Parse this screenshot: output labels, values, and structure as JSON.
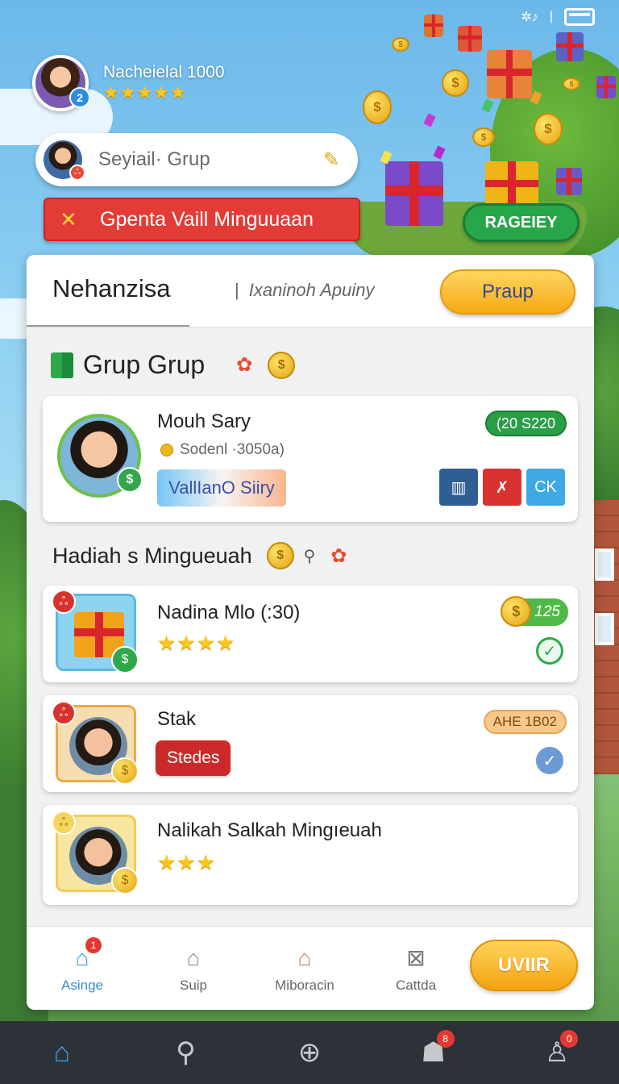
{
  "profile": {
    "name": "Nacheielal 1000",
    "level": "2",
    "stars": "★★★★★"
  },
  "group_field": {
    "text": "Seyiail· Grup",
    "avatar_badge": "ஃ"
  },
  "banner": {
    "text": "Gpenta Vaill Minguuaan"
  },
  "rageiey_button": "RAGEIEY",
  "panel": {
    "tab_active": "Nehanzisa",
    "tab_secondary": "Ixaninoh Apuiny",
    "praup_button": "Praup"
  },
  "section1": {
    "title": "Grup Grup"
  },
  "group_card": {
    "name": "Mouh Sary",
    "sub": "Sodenl ·3050a)",
    "tag": "VallIanO Siiry",
    "pill": "(20 S220",
    "buttons": [
      "▥",
      "✗",
      "CK"
    ]
  },
  "section2": {
    "title": "Hadiah s Mingueuah"
  },
  "rewards": [
    {
      "title": "Nadina Mlo (:30)",
      "stars": "★★★★",
      "coin_value": "125",
      "badge": "ஃ"
    },
    {
      "title": "Stak",
      "action": "Stedes",
      "pill": "AHE 1B02",
      "badge": "ஃ"
    },
    {
      "title": "Nalikah Salkah Mingıeuah",
      "stars": "★★★",
      "badge": "ஃ"
    }
  ],
  "app_nav": {
    "items": [
      {
        "label": "Asinge",
        "badge": "1"
      },
      {
        "label": "Suip"
      },
      {
        "label": "Miboracin"
      },
      {
        "label": "Cattda"
      }
    ],
    "cta": "UVIIR"
  },
  "system_nav": {
    "badges": [
      "8",
      "0"
    ]
  },
  "colors": {
    "accent_blue": "#3b8ed6",
    "danger_red": "#e33b36",
    "success_green": "#27a64a",
    "gold": "#f5a914"
  }
}
